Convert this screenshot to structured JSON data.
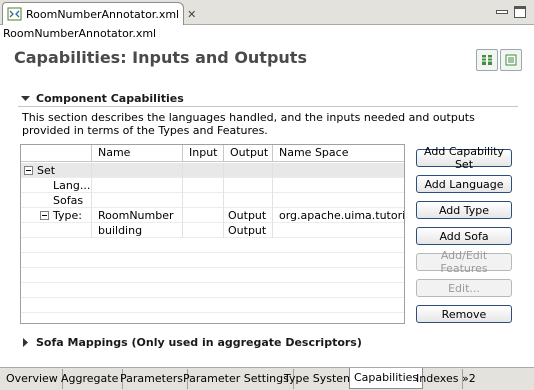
{
  "editor": {
    "tab_title": "RoomNumberAnnotator.xml",
    "tab_icon": "xml-file-icon",
    "close_glyph": "✕",
    "path_label": "RoomNumberAnnotator.xml"
  },
  "page": {
    "title": "Capabilities: Inputs and Outputs",
    "header_buttons": [
      "layout-grid-icon",
      "layout-list-icon"
    ]
  },
  "section": {
    "title": "Component Capabilities",
    "description": "This section describes the languages handled, and the inputs needed and outputs provided in terms of the Types and Features."
  },
  "table": {
    "columns": [
      "Name",
      "Input",
      "Output",
      "Name Space"
    ],
    "rows": [
      {
        "tree": "Set",
        "name": "",
        "input": "",
        "output": "",
        "namespace": "",
        "expander": true
      },
      {
        "tree": "Lang...",
        "name": "",
        "input": "",
        "output": "",
        "namespace": "",
        "expander": false
      },
      {
        "tree": "Sofas",
        "name": "",
        "input": "",
        "output": "",
        "namespace": "",
        "expander": false
      },
      {
        "tree": "Type:",
        "name": "RoomNumber",
        "input": "",
        "output": "Output",
        "namespace": "org.apache.uima.tutorial",
        "expander": true
      },
      {
        "tree": "",
        "name": "building",
        "input": "",
        "output": "Output",
        "namespace": "",
        "expander": false
      }
    ]
  },
  "buttons": {
    "add_capability_set": "Add Capability Set",
    "add_language": "Add Language",
    "add_type": "Add Type",
    "add_sofa": "Add Sofa",
    "add_edit_features": "Add/Edit Features",
    "edit": "Edit...",
    "remove": "Remove"
  },
  "section2": {
    "title": "Sofa Mappings (Only used in aggregate Descriptors)"
  },
  "page_tabs": [
    "Overview",
    "Aggregate",
    "Parameters",
    "Parameter Settings",
    "Type System",
    "Capabilities",
    "Indexes",
    "»2"
  ],
  "active_tab": "Capabilities",
  "colors": {
    "button_border": "#2a4f7c",
    "title_text": "#4a4a4a",
    "chrome_background": "#e4e2dc"
  }
}
